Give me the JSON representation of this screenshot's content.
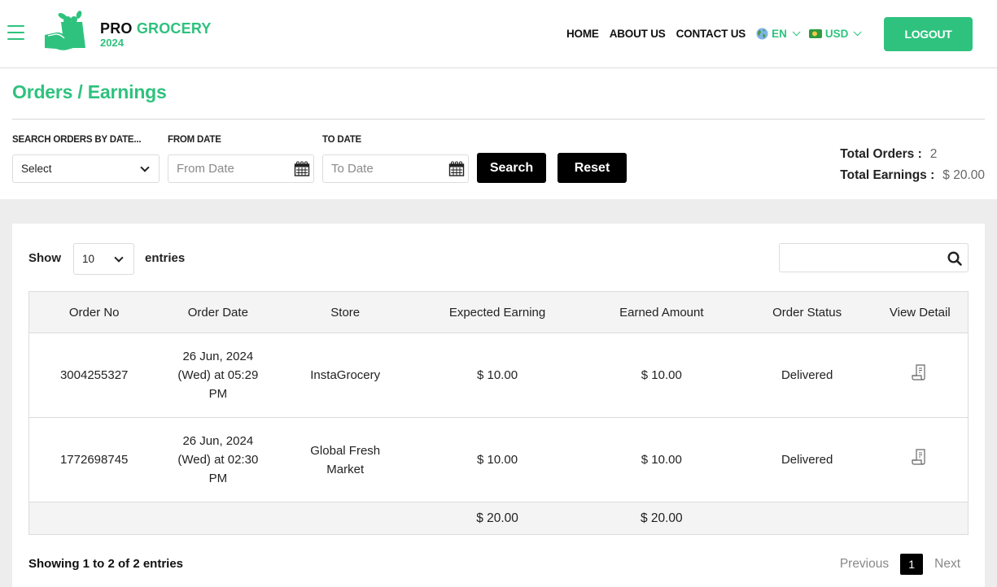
{
  "header": {
    "logo": {
      "line1_a": "PRO",
      "line1_b": "GROCERY",
      "line2": "2024"
    },
    "nav": [
      "HOME",
      "ABOUT US",
      "CONTACT US"
    ],
    "language": {
      "icon": "globe-icon",
      "value": "EN"
    },
    "currency": {
      "icon": "cash-icon",
      "value": "USD"
    },
    "logout_label": "LOGOUT"
  },
  "page": {
    "title": "Orders / Earnings"
  },
  "filters": {
    "search_by_label": "SEARCH ORDERS BY DATE...",
    "search_by_value": "Select",
    "from_label": "FROM DATE",
    "from_placeholder": "From Date",
    "from_value": "",
    "to_label": "TO DATE",
    "to_placeholder": "To Date",
    "to_value": "",
    "search_button": "Search",
    "reset_button": "Reset"
  },
  "totals": {
    "orders_label": "Total Orders :",
    "orders_value": "2",
    "earnings_label": "Total Earnings :",
    "earnings_value": "$ 20.00"
  },
  "table_controls": {
    "show_label": "Show",
    "page_length": "10",
    "entries_label": "entries",
    "search_value": ""
  },
  "table": {
    "columns": [
      "Order No",
      "Order Date",
      "Store",
      "Expected Earning",
      "Earned Amount",
      "Order Status",
      "View Detail"
    ],
    "rows": [
      {
        "order_no": "3004255327",
        "date_line1": "26 Jun, 2024",
        "date_line2": "(Wed) at 05:29",
        "date_line3": "PM",
        "store": "InstaGrocery",
        "expected": "$ 10.00",
        "earned": "$ 10.00",
        "status": "Delivered"
      },
      {
        "order_no": "1772698745",
        "date_line1": "26 Jun, 2024",
        "date_line2": "(Wed) at 02:30",
        "date_line3": "PM",
        "store": "Global Fresh Market",
        "expected": "$ 10.00",
        "earned": "$ 10.00",
        "status": "Delivered"
      }
    ],
    "footer": {
      "expected_total": "$ 20.00",
      "earned_total": "$ 20.00"
    }
  },
  "pagination": {
    "info": "Showing 1 to 2 of 2 entries",
    "previous": "Previous",
    "current": "1",
    "next": "Next"
  },
  "colors": {
    "brand": "#2ec27e",
    "button_dark": "#000000"
  }
}
